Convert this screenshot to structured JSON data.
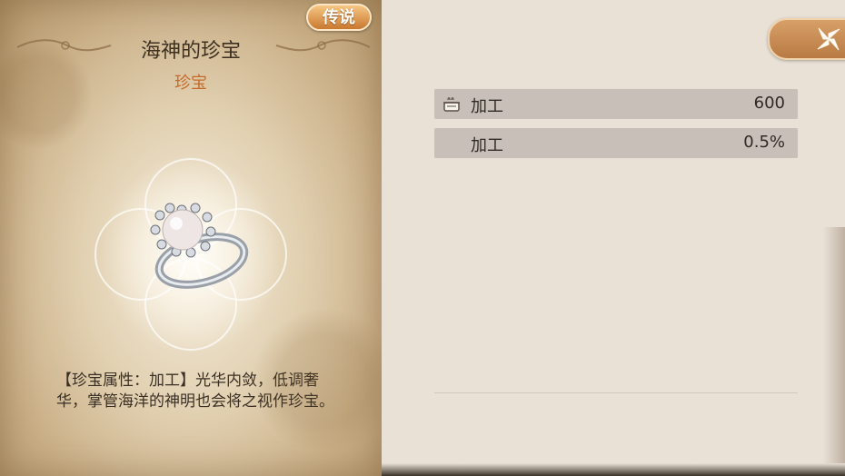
{
  "item": {
    "rarity": "传说",
    "name": "海神的珍宝",
    "type": "珍宝",
    "description": "【珍宝属性：加工】光华内敛，低调奢华，掌管海洋的神明也会将之视作珍宝。",
    "icon": "pearl-ring"
  },
  "stats": [
    {
      "icon": "pot-icon",
      "label": "加工",
      "value": "600"
    },
    {
      "icon": "",
      "label": "加工",
      "value": "0.5%"
    }
  ],
  "colors": {
    "rarity_badge": "#d98a3c",
    "type_text": "#c46a2a",
    "stat_row_bg": "#c8c0b8",
    "close_button": "#c98b52"
  },
  "close_icon": "close-icon"
}
